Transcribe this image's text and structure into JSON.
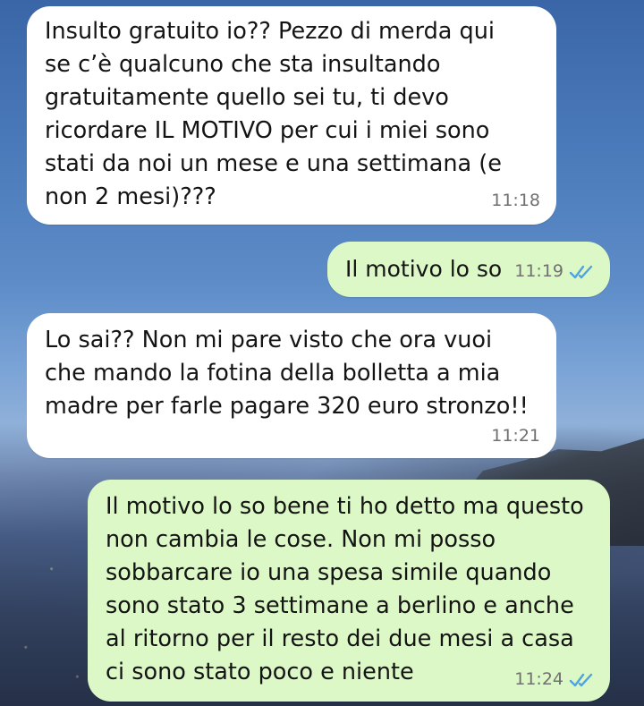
{
  "conversation": {
    "messages": [
      {
        "direction": "incoming",
        "text": "Insulto gratuito io?? Pezzo di merda qui\nse c’è qualcuno  che sta insultando\ngratuitamente quello sei tu, ti devo\nricordare IL MOTIVO per cui i miei sono\nstati da noi un mese e una settimana (e\nnon 2 mesi)???",
        "time": "11:18"
      },
      {
        "direction": "outgoing",
        "text": "Il motivo lo so",
        "time": "11:19",
        "status_icon": "double-check-read-icon"
      },
      {
        "direction": "incoming",
        "text": "Lo sai?? Non mi pare visto che ora vuoi\nche mando la fotina della bolletta a mia\nmadre per farle pagare 320 euro stronzo!!",
        "time": "11:21"
      },
      {
        "direction": "outgoing",
        "text": "Il motivo lo so bene ti ho detto ma questo\nnon cambia le cose. Non mi posso\nsobbarcare io una spesa simile quando\nsono stato 3 settimane a berlino e anche\nal ritorno per il resto dei due mesi a casa\nci sono stato poco e niente",
        "time": "11:24",
        "status_icon": "double-check-read-icon"
      }
    ]
  },
  "colors": {
    "incoming_bubble": "#ffffff",
    "outgoing_bubble": "#dcf8c6",
    "read_tick": "#4fa3e0",
    "time_text": "#707070"
  }
}
